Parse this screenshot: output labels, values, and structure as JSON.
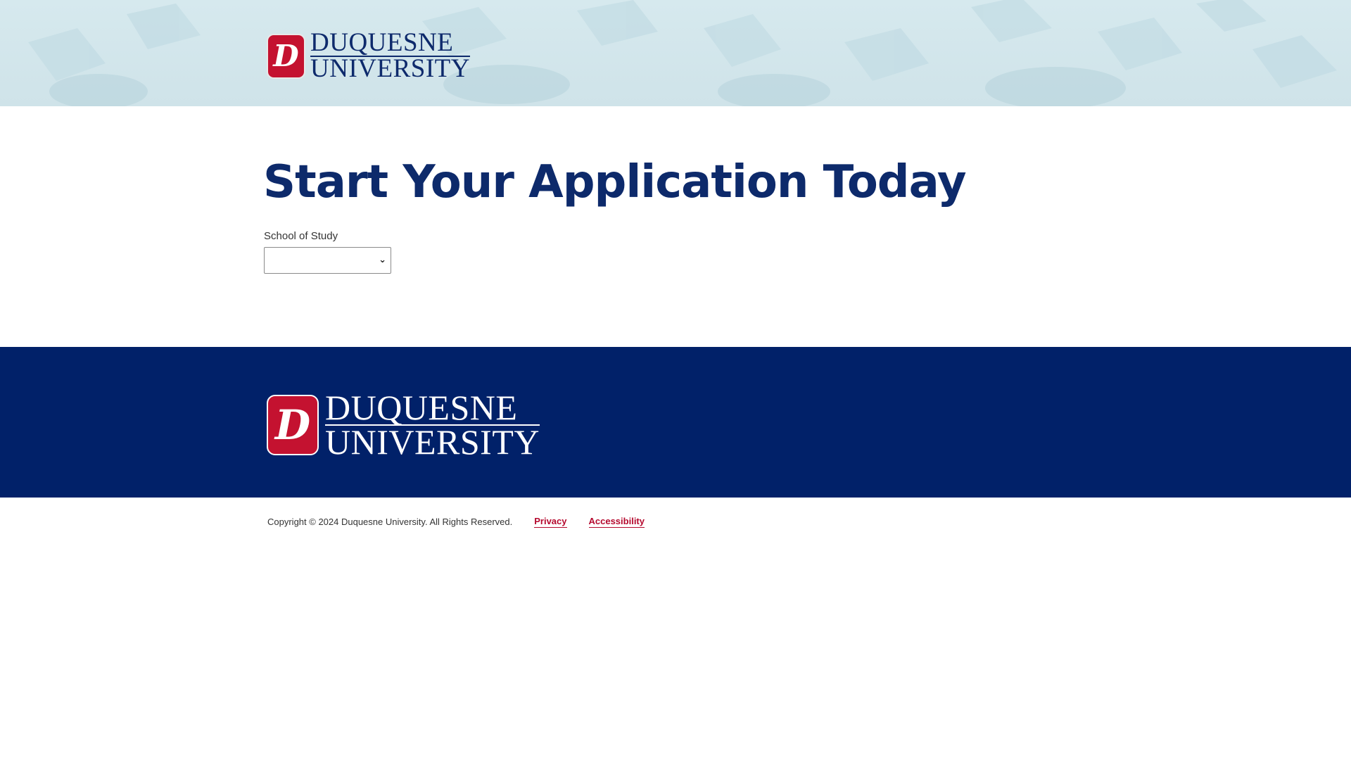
{
  "header": {
    "logo": {
      "shield_letter": "D",
      "line1": "DUQUESNE",
      "line2": "UNIVERSITY"
    }
  },
  "main": {
    "title": "Start Your Application Today",
    "school_field": {
      "label": "School of Study",
      "value": ""
    }
  },
  "footer": {
    "logo": {
      "shield_letter": "D",
      "line1": "DUQUESNE",
      "line2": "UNIVERSITY"
    },
    "copyright": "Copyright © 2024 Duquesne University. All Rights Reserved.",
    "links": {
      "privacy": "Privacy",
      "accessibility": "Accessibility"
    }
  },
  "colors": {
    "navy": "#012169",
    "title_navy": "#0d2a6b",
    "red": "#c41230",
    "link_red": "#b5092e",
    "header_bg": "#d6e9ee"
  },
  "icons": {
    "select_arrow": "chevron-down-icon"
  }
}
